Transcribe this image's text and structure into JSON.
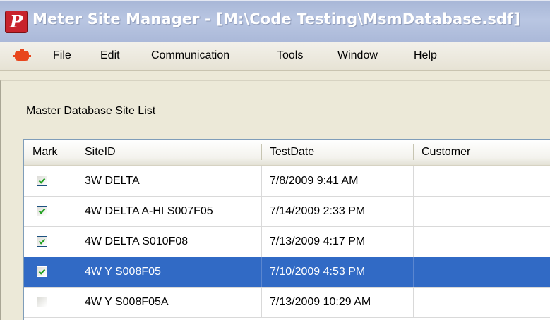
{
  "window": {
    "title": "Meter Site Manager - [M:\\Code Testing\\MsmDatabase.sdf]",
    "app_icon_letter": "P"
  },
  "menu": {
    "icon": "mdi-child-icon",
    "items": [
      "File",
      "Edit",
      "Communication",
      "Tools",
      "Window",
      "Help"
    ]
  },
  "section": {
    "label": "Master Database Site List"
  },
  "grid": {
    "columns": [
      "Mark",
      "SiteID",
      "TestDate",
      "Customer"
    ],
    "rows": [
      {
        "mark": true,
        "site_id": "3W DELTA",
        "test_date": "7/8/2009 9:41 AM",
        "customer": "",
        "selected": false
      },
      {
        "mark": true,
        "site_id": "4W DELTA A-HI S007F05",
        "test_date": "7/14/2009 2:33 PM",
        "customer": "",
        "selected": false
      },
      {
        "mark": true,
        "site_id": "4W DELTA S010F08",
        "test_date": "7/13/2009 4:17 PM",
        "customer": "",
        "selected": false
      },
      {
        "mark": true,
        "site_id": "4W Y S008F05",
        "test_date": "7/10/2009 4:53 PM",
        "customer": "",
        "selected": true
      },
      {
        "mark": false,
        "site_id": "4W Y S008F05A",
        "test_date": "7/13/2009 10:29 AM",
        "customer": "",
        "selected": false
      }
    ]
  },
  "colors": {
    "selection": "#316ac5",
    "check": "#21a121",
    "title_bar": "#a8b7d7"
  }
}
